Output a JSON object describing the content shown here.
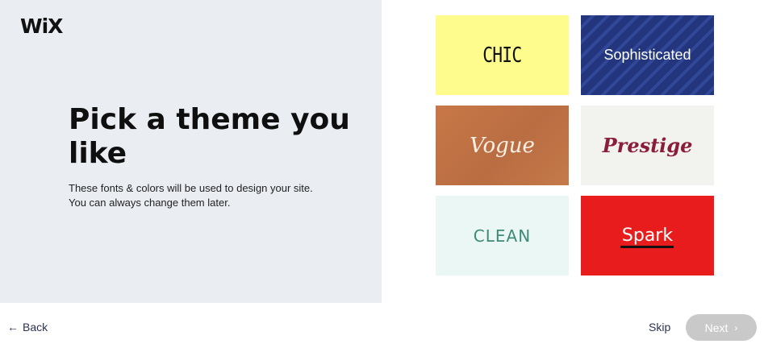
{
  "brand": {
    "logo_text": "WiX"
  },
  "intro": {
    "heading": "Pick a theme you like",
    "description_line1": "These fonts & colors will be used to design your site.",
    "description_line2": "You can always change them later."
  },
  "themes": [
    {
      "label": "CHIC",
      "bg_color": "#fdfc8c"
    },
    {
      "label": "Sophisticated",
      "bg_color": "#23357c"
    },
    {
      "label": "Vogue",
      "bg_color": "#c0744a"
    },
    {
      "label": "Prestige",
      "bg_color": "#f2f2ee"
    },
    {
      "label": "CLEAN",
      "bg_color": "#eaf7f4"
    },
    {
      "label": "Spark",
      "bg_color": "#e81c1c"
    }
  ],
  "footer": {
    "back_arrow": "←",
    "back_label": "Back",
    "skip_label": "Skip",
    "next_label": "Next",
    "next_chevron": "›"
  },
  "colors": {
    "left_panel": "#eaedf2",
    "next_disabled": "#c9c9c9",
    "link_text": "#2b3350"
  }
}
